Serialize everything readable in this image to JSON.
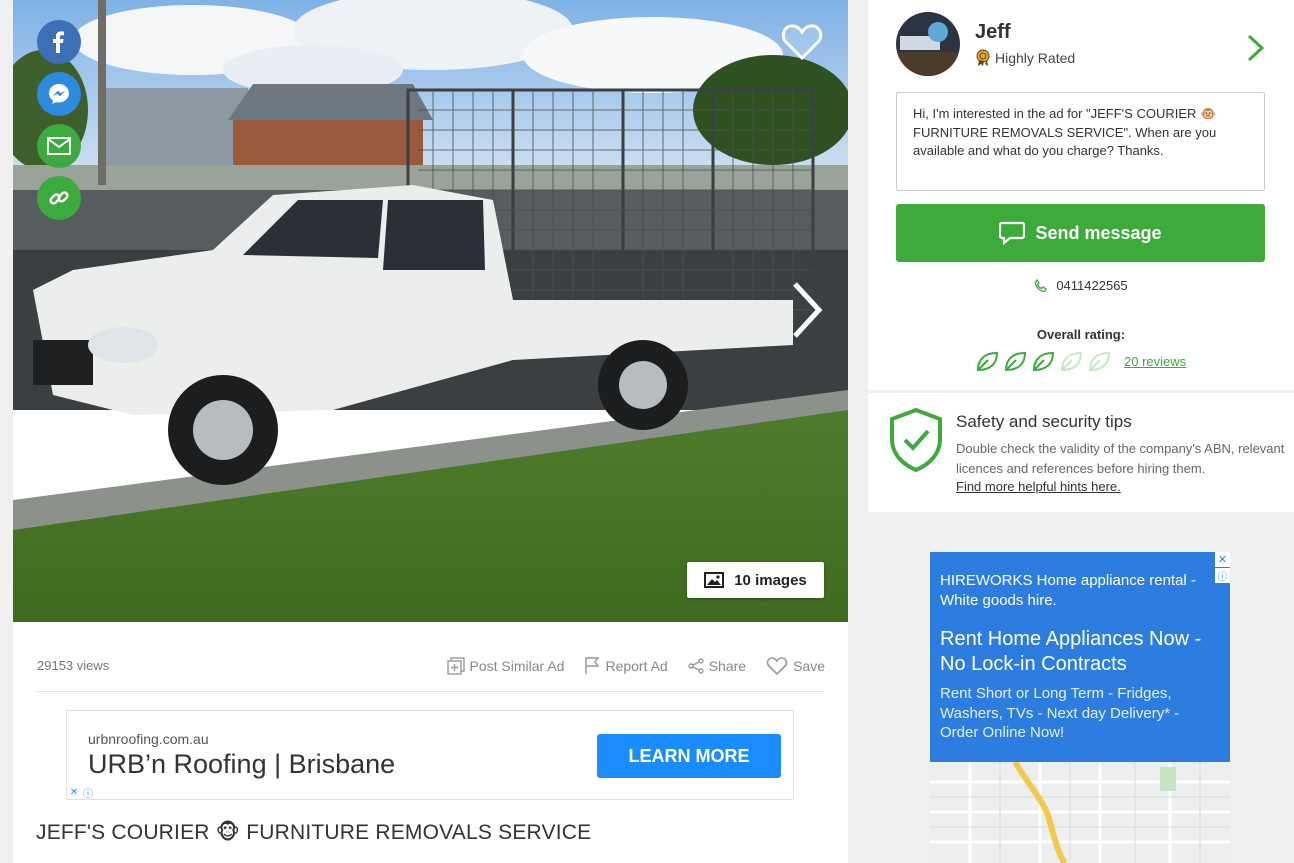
{
  "gallery": {
    "image_count_label": "10 images",
    "share_buttons": [
      "facebook-icon",
      "messenger-icon",
      "email-icon",
      "link-icon"
    ]
  },
  "listing": {
    "views": "29153 views",
    "actions": {
      "post_similar": "Post Similar Ad",
      "report": "Report Ad",
      "share": "Share",
      "save": "Save"
    },
    "title": "JEFF'S COURIER 🐵 FURNITURE REMOVALS SERVICE"
  },
  "inline_ad": {
    "domain": "urbnroofing.com.au",
    "title": "URB’n Roofing | Brisbane",
    "cta": "LEARN MORE"
  },
  "seller": {
    "name": "Jeff",
    "badge": "Highly Rated",
    "message": "Hi, I'm interested in the ad for \"JEFF'S COURIER 🐵 FURNITURE REMOVALS SERVICE\". When are you available and what do you charge? Thanks.",
    "send_label": "Send message",
    "phone": "0411422565",
    "rating_label": "Overall rating:",
    "rating_value": 3,
    "rating_max": 5,
    "reviews_label": "20 reviews"
  },
  "safety": {
    "title": "Safety and security tips",
    "text": "Double check the validity of the company's ABN, relevant licences and references before hiring them.",
    "link": "Find more helpful hints here."
  },
  "side_ad": {
    "headline": "HIREWORKS Home appliance rental - White goods hire.",
    "title": "Rent Home Appliances Now - No Lock-in Contracts",
    "body": "Rent Short or Long Term - Fridges, Washers, TVs - Next day Delivery* - Order Online Now!"
  },
  "colors": {
    "brand_green": "#3daa3c",
    "ad_blue": "#1a8cff",
    "side_ad_blue": "#2d7de0"
  }
}
